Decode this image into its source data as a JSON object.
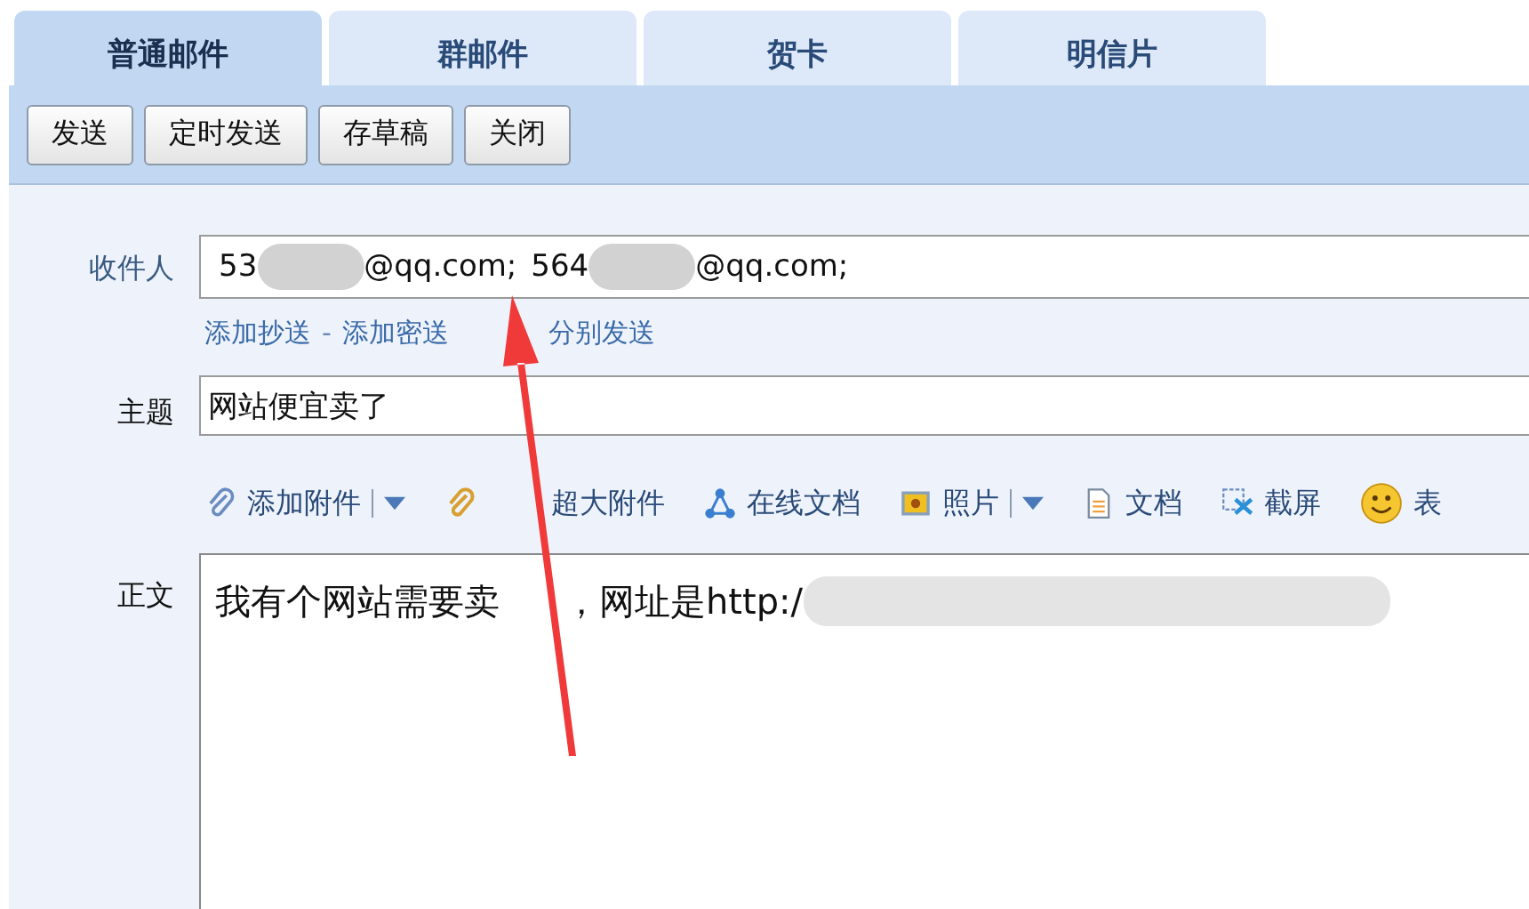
{
  "tabs": [
    {
      "label": "普通邮件",
      "selected": true
    },
    {
      "label": "群邮件",
      "selected": false
    },
    {
      "label": "贺卡",
      "selected": false
    },
    {
      "label": "明信片",
      "selected": false
    }
  ],
  "actions": [
    "发送",
    "定时发送",
    "存草稿",
    "关闭"
  ],
  "recipients": {
    "label": "收件人",
    "entries": [
      {
        "start": "53",
        "end": "@qq.com;"
      },
      {
        "start": "564",
        "end": "@qq.com;"
      }
    ]
  },
  "recipient_links": [
    {
      "kind": "link",
      "text": "添加抄送"
    },
    {
      "kind": "separator",
      "text": "-"
    },
    {
      "kind": "link",
      "text": "添加密送"
    },
    {
      "kind": "link",
      "text": "分别发送"
    }
  ],
  "subject": {
    "label": "主题",
    "value": "网站便宜卖了"
  },
  "attach_tools": [
    {
      "kind": "clip",
      "label": "添加附件",
      "menu": true
    },
    {
      "kind": "bigclip",
      "label": "超大附件",
      "menu": false
    },
    {
      "kind": "share",
      "label": "在线文档",
      "menu": false
    },
    {
      "kind": "photo",
      "label": "照片",
      "menu": true
    },
    {
      "kind": "doc",
      "label": "文档",
      "menu": false
    },
    {
      "kind": "screenshot",
      "label": "截屏",
      "menu": false
    },
    {
      "kind": "emoji",
      "label": "表",
      "menu": false
    }
  ],
  "body": {
    "label": "正文",
    "parts": [
      "我有个网站需要卖",
      "，网址是http:/"
    ]
  }
}
